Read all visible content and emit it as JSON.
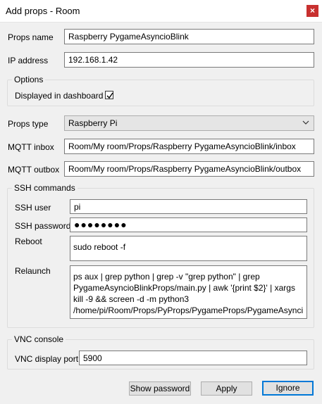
{
  "window": {
    "title": "Add props - Room",
    "close_label": "×"
  },
  "form": {
    "props_name_label": "Props name",
    "props_name_value": "Raspberry PygameAsyncioBlink",
    "ip_label": "IP address",
    "ip_value": "192.168.1.42",
    "options_title": "Options",
    "displayed_label": "Displayed in dashboard",
    "displayed_checked": true,
    "props_type_label": "Props type",
    "props_type_value": "Raspberry Pi",
    "mqtt_inbox_label": "MQTT inbox",
    "mqtt_inbox_value": "Room/My room/Props/Raspberry PygameAsyncioBlink/inbox",
    "mqtt_outbox_label": "MQTT outbox",
    "mqtt_outbox_value": "Room/My room/Props/Raspberry PygameAsyncioBlink/outbox"
  },
  "ssh": {
    "title": "SSH commands",
    "user_label": "SSH user",
    "user_value": "pi",
    "password_label": "SSH password",
    "password_value": "●●●●●●●●",
    "reboot_label": "Reboot",
    "reboot_value": "sudo reboot -f",
    "relaunch_label": "Relaunch",
    "relaunch_value": "ps aux | grep python | grep -v \"grep python\" | grep PygameAsyncioBlinkProps/main.py | awk '{print $2}' | xargs kill -9 && screen -d -m python3 /home/pi/Room/Props/PyProps/PygameProps/PygameAsyncioBlinkProps/main.py -s %BROKER%"
  },
  "vnc": {
    "title": "VNC console",
    "port_label": "VNC display port",
    "port_value": "5900"
  },
  "buttons": {
    "show_password": "Show password",
    "apply": "Apply",
    "ignore": "Ignore"
  },
  "colors": {
    "accent": "#0078d7",
    "close": "#c8302f"
  }
}
